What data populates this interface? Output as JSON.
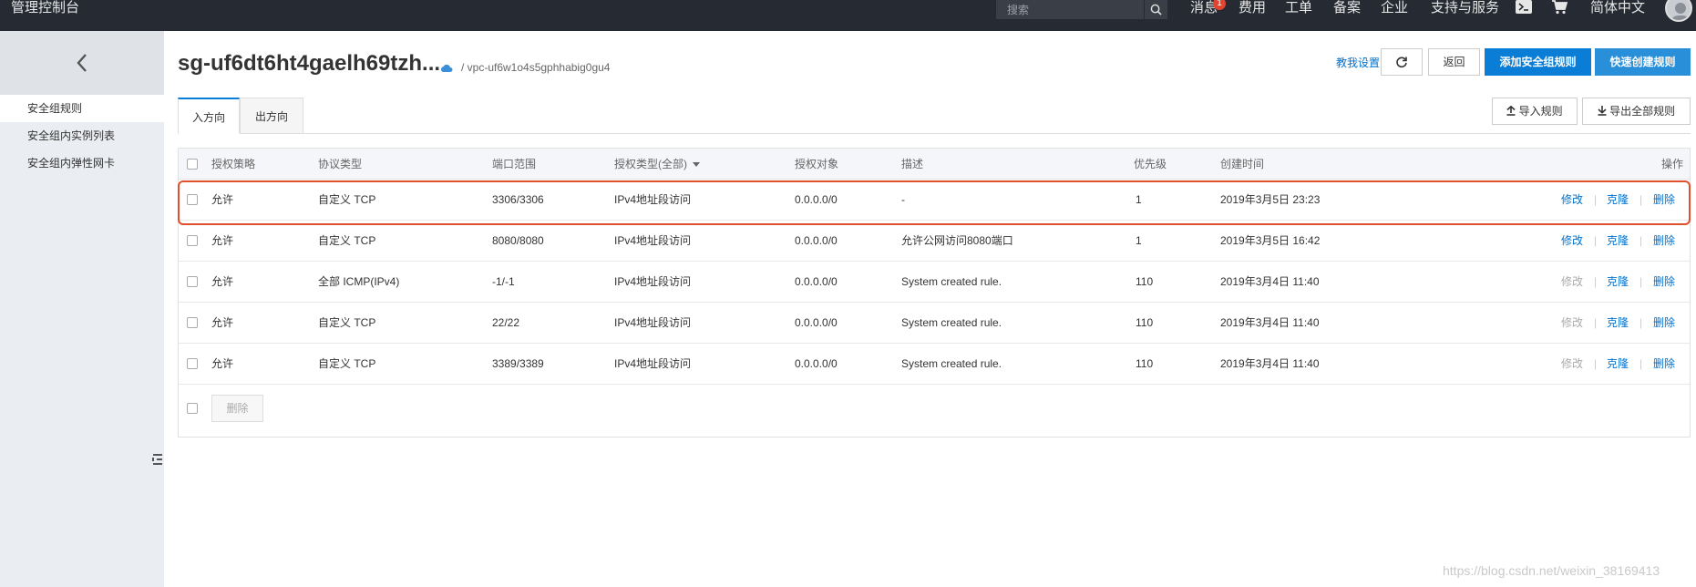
{
  "topbar": {
    "brand": "管理控制台",
    "search_placeholder": "搜索",
    "nav": [
      {
        "label": "消息"
      },
      {
        "label": "费用"
      },
      {
        "label": "工单"
      },
      {
        "label": "备案"
      },
      {
        "label": "企业"
      },
      {
        "label": "支持与服务"
      },
      {
        "label": "简体中文"
      }
    ],
    "badge_count": "1"
  },
  "sidebar": {
    "items": [
      {
        "label": "安全组规则"
      },
      {
        "label": "安全组内实例列表"
      },
      {
        "label": "安全组内弹性网卡"
      }
    ]
  },
  "header": {
    "title": "sg-uf6dt6ht4gaelh69tzh...",
    "vpc": "/ vpc-uf6w1o4s5gphhabig0gu4",
    "help_link": "教我设置",
    "back_label": "返回",
    "add_rule_label": "添加安全组规则",
    "quick_rule_label": "快速创建规则"
  },
  "tabs": [
    {
      "label": "入方向"
    },
    {
      "label": "出方向"
    }
  ],
  "toolbar": {
    "import_label": "导入规则",
    "export_label": "导出全部规则"
  },
  "table": {
    "columns": {
      "policy": "授权策略",
      "protocol": "协议类型",
      "port": "端口范围",
      "auth_type": "授权类型(全部)",
      "object": "授权对象",
      "desc": "描述",
      "priority": "优先级",
      "created": "创建时间",
      "actions": "操作"
    },
    "action_labels": {
      "edit": "修改",
      "clone": "克隆",
      "delete": "删除",
      "sep": "|"
    },
    "rows": [
      {
        "policy": "允许",
        "protocol": "自定义 TCP",
        "port": "3306/3306",
        "auth_type": "IPv4地址段访问",
        "object": "0.0.0.0/0",
        "desc": "-",
        "priority": "1",
        "created": "2019年3月5日 23:23"
      },
      {
        "policy": "允许",
        "protocol": "自定义 TCP",
        "port": "8080/8080",
        "auth_type": "IPv4地址段访问",
        "object": "0.0.0.0/0",
        "desc": "允许公网访问8080端口",
        "priority": "1",
        "created": "2019年3月5日 16:42"
      },
      {
        "policy": "允许",
        "protocol": "全部 ICMP(IPv4)",
        "port": "-1/-1",
        "auth_type": "IPv4地址段访问",
        "object": "0.0.0.0/0",
        "desc": "System created rule.",
        "priority": "110",
        "created": "2019年3月4日 11:40"
      },
      {
        "policy": "允许",
        "protocol": "自定义 TCP",
        "port": "22/22",
        "auth_type": "IPv4地址段访问",
        "object": "0.0.0.0/0",
        "desc": "System created rule.",
        "priority": "110",
        "created": "2019年3月4日 11:40"
      },
      {
        "policy": "允许",
        "protocol": "自定义 TCP",
        "port": "3389/3389",
        "auth_type": "IPv4地址段访问",
        "object": "0.0.0.0/0",
        "desc": "System created rule.",
        "priority": "110",
        "created": "2019年3月4日 11:40"
      }
    ],
    "bulk_delete_label": "删除"
  },
  "watermark": "https://blog.csdn.net/weixin_38169413",
  "colors": {
    "topbar": "#262b33",
    "primary": "#0a7ed6",
    "highlight": "#e0502c",
    "link": "#0070cc"
  }
}
